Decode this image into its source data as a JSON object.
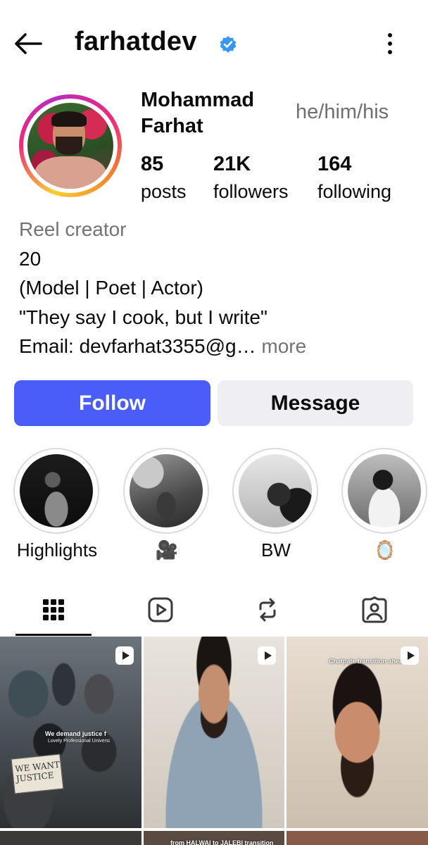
{
  "header": {
    "username": "farhatdev",
    "back_icon": "arrow-left-icon",
    "verified_icon": "verified-badge-icon",
    "menu_icon": "more-vertical-icon"
  },
  "profile": {
    "full_name": "Mohammad Farhat",
    "pronouns": "he/him/his",
    "stats": [
      {
        "value": "85",
        "label": "posts"
      },
      {
        "value": "21K",
        "label": "followers"
      },
      {
        "value": "164",
        "label": "following"
      }
    ],
    "bio": {
      "category": "Reel creator",
      "lines": [
        "20",
        "(Model | Poet | Actor)",
        "\"They say I cook, but I write\""
      ],
      "email_prefix": "Email: devfarhat3355@g…",
      "more_label": " more"
    }
  },
  "actions": {
    "follow_label": "Follow",
    "message_label": "Message"
  },
  "highlights": [
    {
      "label": "Highlights"
    },
    {
      "label": "🎥"
    },
    {
      "label": "BW"
    },
    {
      "label": "🪞"
    }
  ],
  "tabs": [
    {
      "icon": "grid-icon",
      "active": true
    },
    {
      "icon": "reels-icon",
      "active": false
    },
    {
      "icon": "repost-icon",
      "active": false
    },
    {
      "icon": "tagged-icon",
      "active": false
    }
  ],
  "grid": {
    "posts": [
      {
        "overlay": "We demand justice f",
        "overlay2": "Lovely Professional Universi",
        "sign": "WE WANT JUSTICE"
      },
      {
        "overlay": ""
      },
      {
        "overlay": "Chatpate transition ahead"
      }
    ],
    "row2_overlay": "from HALWAI to JALEBI transition"
  },
  "colors": {
    "follow_button": "#4a5df9",
    "message_button": "#efeff3",
    "muted_text": "#737373",
    "verified": "#3897f0"
  }
}
